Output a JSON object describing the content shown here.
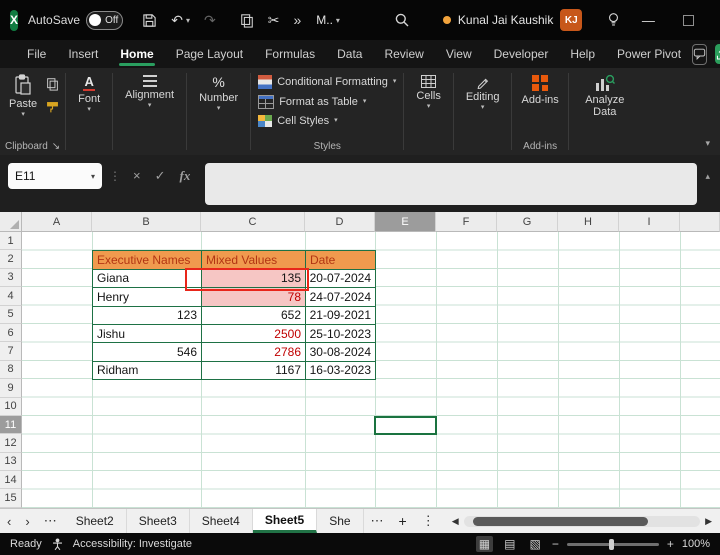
{
  "colors": {
    "accent_green": "#217346",
    "active_tab_underline": "#2a9e5f",
    "table_header_fill": "#f09a4e",
    "table_header_text": "#b23513",
    "table_border": "#1e7145",
    "conditional_fill_pink": "#f6c6c4",
    "conditional_text_red": "#c00000",
    "annotation_red": "#e8261a",
    "addins_orange": "#e8590c",
    "avatar_orange": "#c7571a",
    "selection_green": "#1a7340"
  },
  "titlebar": {
    "autosave_label": "AutoSave",
    "autosave_state": "Off",
    "quick_menu_label": "M..",
    "user_name": "Kunal Jai Kaushik",
    "user_initials": "KJ"
  },
  "menubar": {
    "tabs": [
      {
        "label": "File"
      },
      {
        "label": "Insert"
      },
      {
        "label": "Home"
      },
      {
        "label": "Page Layout"
      },
      {
        "label": "Formulas"
      },
      {
        "label": "Data"
      },
      {
        "label": "Review"
      },
      {
        "label": "View"
      },
      {
        "label": "Developer"
      },
      {
        "label": "Help"
      },
      {
        "label": "Power Pivot"
      }
    ],
    "active_tab": "Home"
  },
  "ribbon": {
    "paste_label": "Paste",
    "clipboard_group_label": "Clipboard",
    "font_label": "Font",
    "alignment_label": "Alignment",
    "number_label": "Number",
    "conditional_formatting_label": "Conditional Formatting",
    "format_as_table_label": "Format as Table",
    "cell_styles_label": "Cell Styles",
    "styles_group_label": "Styles",
    "cells_label": "Cells",
    "editing_label": "Editing",
    "addins_button_label": "Add-ins",
    "addins_group_label": "Add-ins",
    "analyze_data_label": "Analyze Data"
  },
  "formula_bar": {
    "name_box_value": "E11",
    "fx_label": "fx",
    "formula_value": ""
  },
  "grid": {
    "column_headers": [
      "A",
      "B",
      "C",
      "D",
      "E",
      "F",
      "G",
      "H",
      "I"
    ],
    "row_headers": [
      "1",
      "2",
      "3",
      "4",
      "5",
      "6",
      "7",
      "8",
      "9",
      "10",
      "11",
      "12",
      "13",
      "14",
      "15"
    ],
    "selected_cell": "E11",
    "selected_column": "E",
    "selected_row": "11"
  },
  "table": {
    "headers": [
      "Executive Names",
      "Mixed Values",
      "Date"
    ],
    "rows": [
      {
        "name": "Giana",
        "value": "135",
        "date": "20-07-2024"
      },
      {
        "name": "Henry",
        "value": "78",
        "date": "24-07-2024"
      },
      {
        "name": "123",
        "value": "652",
        "date": "21-09-2021"
      },
      {
        "name": "Jishu",
        "value": "2500",
        "date": "25-10-2023"
      },
      {
        "name": "546",
        "value": "2786",
        "date": "30-08-2024"
      },
      {
        "name": "Ridham",
        "value": "1167",
        "date": "16-03-2023"
      }
    ]
  },
  "sheet_tabs": {
    "tabs": [
      {
        "label": "Sheet2"
      },
      {
        "label": "Sheet3"
      },
      {
        "label": "Sheet4"
      },
      {
        "label": "Sheet5"
      },
      {
        "label": "She"
      }
    ],
    "active": "Sheet5"
  },
  "status_bar": {
    "ready_label": "Ready",
    "accessibility_label": "Accessibility: Investigate",
    "zoom_value": "100%"
  },
  "icons": {
    "excel_logo": "X",
    "undo": "↶",
    "redo": "↷",
    "cut": "✂",
    "more_commands": "»",
    "dropdown": "▾",
    "minimize": "—",
    "close": "×",
    "grip": "⋮",
    "cancel": "×",
    "enter": "✓",
    "collapse_formula_bar": "▴",
    "collapse_ribbon": "▾",
    "font_letter": "A",
    "percent": "%",
    "dialog_launcher": "↘",
    "nav_prev": "‹",
    "nav_next": "›",
    "more_sheets": "⋯",
    "add_sheet": "+",
    "context_menu": "⋮",
    "scroll_left": "◀",
    "scroll_right": "▶",
    "view_normal": "▦",
    "view_page_layout": "▤",
    "view_page_break": "▧",
    "zoom_out": "−",
    "zoom_in": "+"
  }
}
